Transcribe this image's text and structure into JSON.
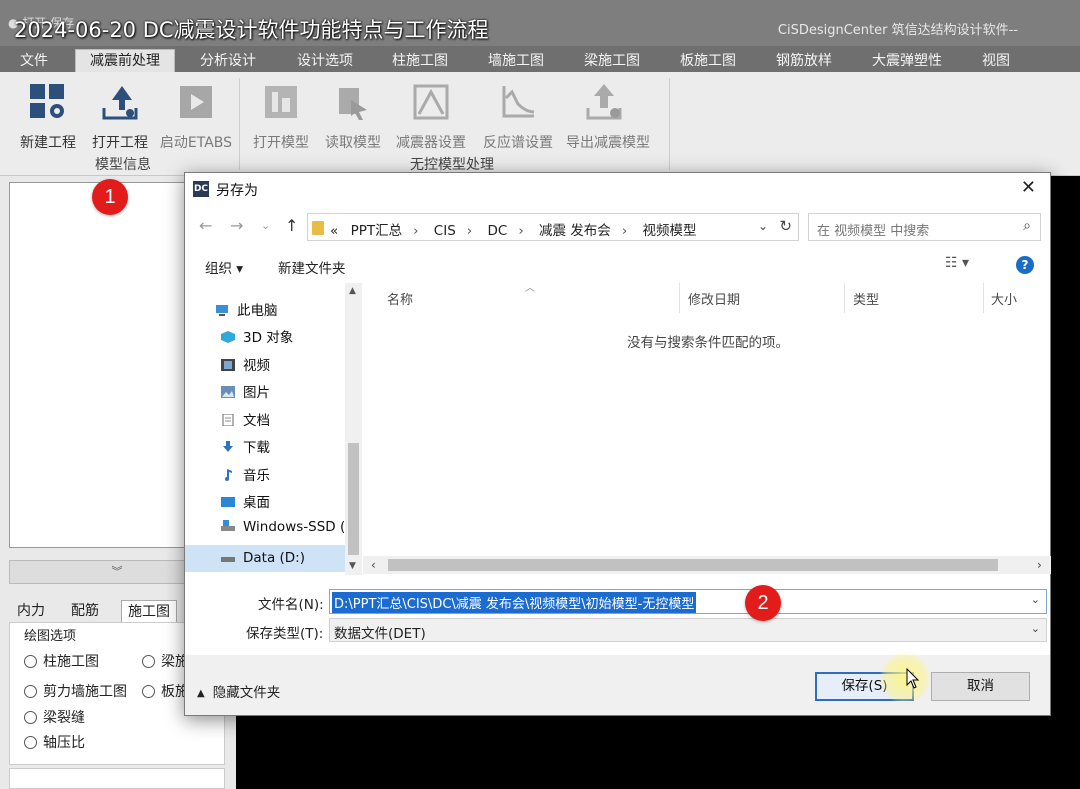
{
  "app": {
    "overlay_title": "2024-06-20 DC减震设计软件功能特点与工作流程",
    "quick_access": "● 打开   保存",
    "app_name": "CiSDesignCenter 筑信达结构设计软件--"
  },
  "menu": [
    "文件",
    "减震前处理",
    "分析设计",
    "设计选项",
    "柱施工图",
    "墙施工图",
    "梁施工图",
    "板施工图",
    "钢筋放样",
    "大震弹塑性",
    "视图"
  ],
  "ribbon": {
    "buttons": [
      "新建工程",
      "打开工程",
      "启动ETABS",
      "打开模型",
      "读取模型",
      "减震器设置",
      "反应谱设置",
      "导出减震模型"
    ],
    "groups": [
      "模型信息",
      "无控模型处理"
    ]
  },
  "left_panel": {
    "tabs": [
      "内力",
      "配筋",
      "施工图"
    ],
    "group_title": "绘图选项",
    "options": [
      "柱施工图",
      "梁施",
      "剪力墙施工图",
      "板施",
      "梁裂缝",
      "轴压比"
    ]
  },
  "dialog": {
    "title": "另存为",
    "close": "✕",
    "breadcrumbs": [
      "PPT汇总",
      "CIS",
      "DC",
      "减震 发布会",
      "视频模型"
    ],
    "breadcrumb_prefix": "«",
    "search_placeholder": "在 视频模型 中搜索",
    "toolbar": {
      "organize": "组织 ▾",
      "new_folder": "新建文件夹",
      "view": "☷ ▾",
      "help": "?"
    },
    "nav": [
      "此电脑",
      "3D 对象",
      "视频",
      "图片",
      "文档",
      "下载",
      "音乐",
      "桌面",
      "Windows-SSD (",
      "Data (D:)"
    ],
    "columns": [
      "名称",
      "修改日期",
      "类型",
      "大小"
    ],
    "empty_message": "没有与搜索条件匹配的项。",
    "filename_label": "文件名(N):",
    "filename_value": "D:\\PPT汇总\\CIS\\DC\\减震 发布会\\视频模型\\初始模型-无控模型",
    "filetype_label": "保存类型(T):",
    "filetype_value": "数据文件(DET)",
    "hide_folders": "隐藏文件夹",
    "save": "保存(S)",
    "cancel": "取消"
  },
  "badges": [
    "1",
    "2"
  ],
  "colors": {
    "badge": "#e21b1b",
    "accent": "#1b6bd0",
    "dark_bg": "#000000",
    "menubar": "#6f6f6f"
  }
}
